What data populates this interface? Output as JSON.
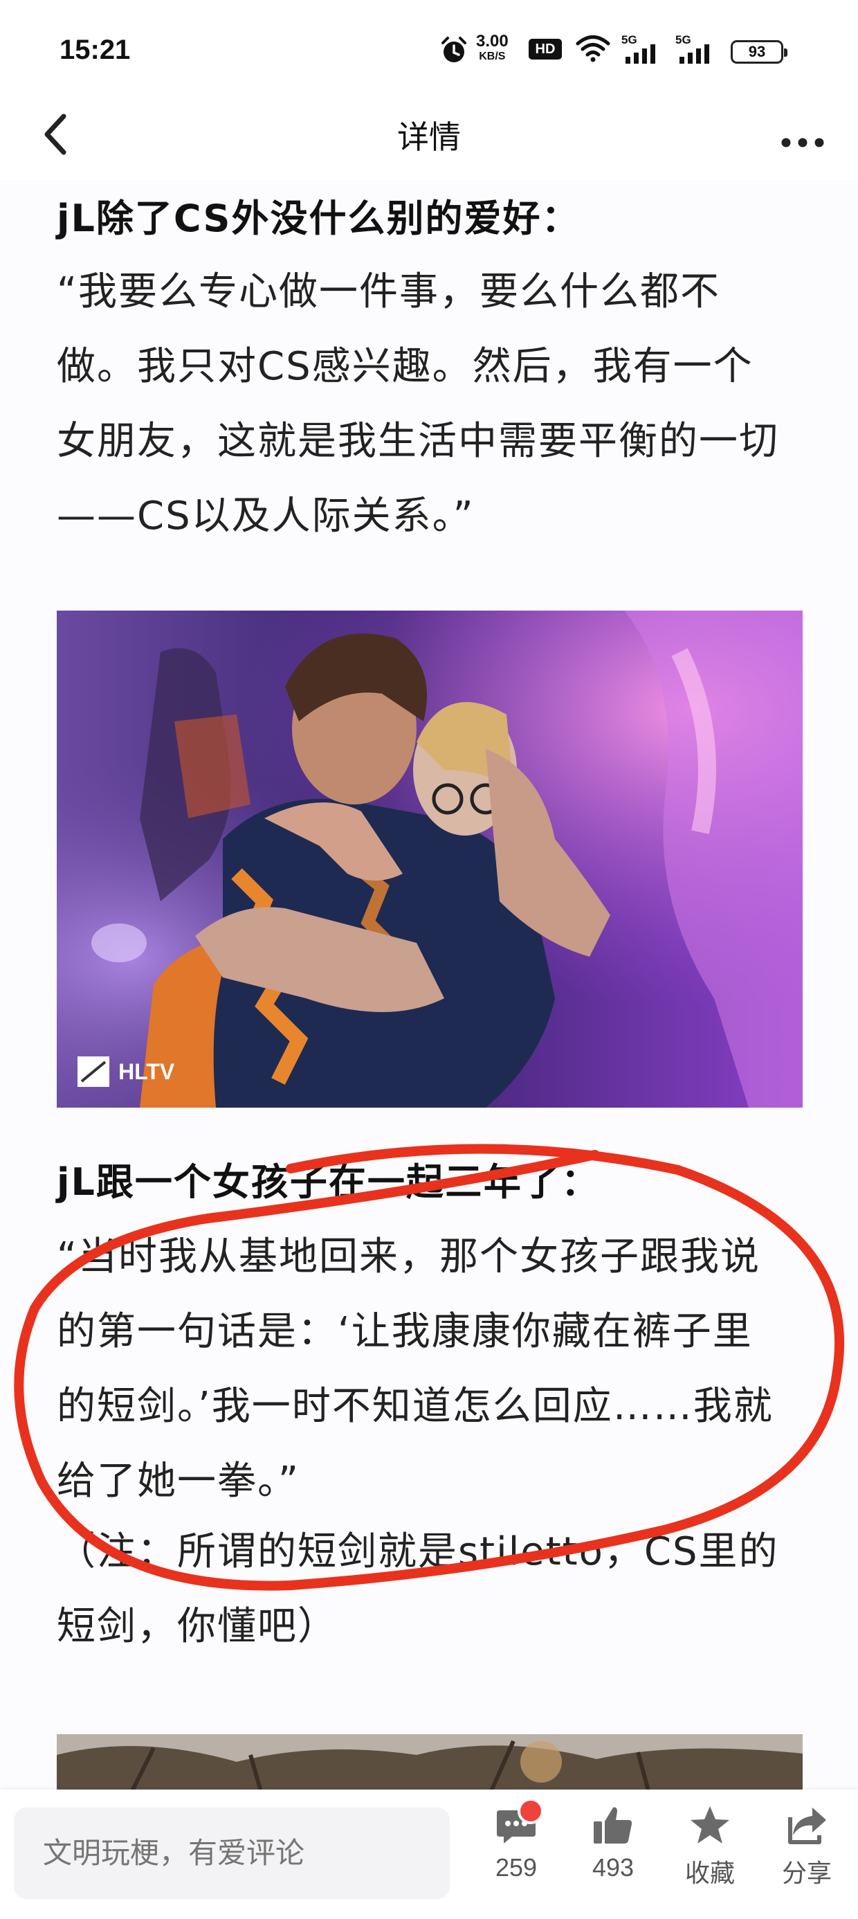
{
  "status_bar": {
    "time": "15:21",
    "net_speed_value": "3.00",
    "net_speed_unit": "KB/S",
    "hd_label": "HD",
    "signal_1": "5G",
    "signal_2": "5G",
    "battery": "93"
  },
  "nav": {
    "title": "详情",
    "back_icon": "chevron-left-icon",
    "more_icon": "more-horizontal-icon"
  },
  "article": {
    "heading_1": "jL除了CS外没什么别的爱好：",
    "quote_1": [
      "“我要么专心做一件事，要么什么都不",
      "做。我只对CS感兴趣。然后，我有一个",
      "女朋友，这就是我生活中需要平衡的一切",
      "——CS以及人际关系。”"
    ],
    "image_1_watermark": "HLTV",
    "heading_2": "jL跟一个女孩子在一起三年了：",
    "quote_2": [
      "“当时我从基地回来，那个女孩子跟我说",
      "的第一句话是：‘让我康康你藏在裤子里",
      "的短剑。’我一时不知道怎么回应……我就",
      "给了她一拳。”"
    ],
    "note": [
      "（注：所谓的短剑就是stiletto，CS里的",
      "短剑，你懂吧）"
    ]
  },
  "bottom_bar": {
    "comment_placeholder": "文明玩梗，有爱评论",
    "comments_count": "259",
    "likes_count": "493",
    "favorite_label": "收藏",
    "share_label": "分享"
  },
  "colors": {
    "accent_red": "#e8321e",
    "badge_red": "#f0413c",
    "icon_gray": "#6a6a6a"
  }
}
